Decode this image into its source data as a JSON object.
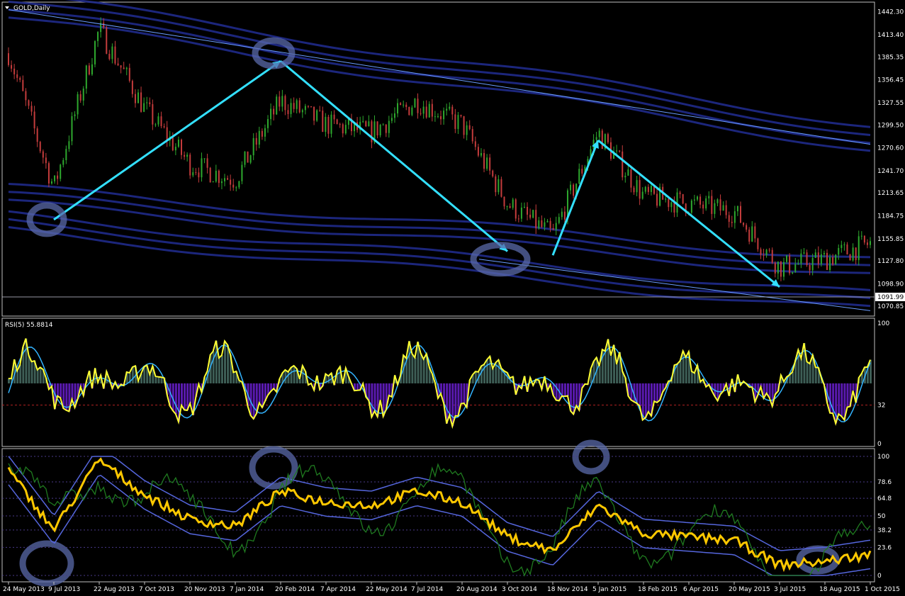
{
  "main": {
    "title": "GOLD,Daily",
    "price_axis": [
      "1442.30",
      "1413.40",
      "1385.35",
      "1356.45",
      "1327.55",
      "1299.50",
      "1270.60",
      "1241.70",
      "1213.65",
      "1184.75",
      "1155.85",
      "1127.80",
      "1098.90",
      "1070.85"
    ],
    "current_price": "1091.99"
  },
  "rsi_panel": {
    "title": "RSI(5) 55.8814",
    "levels": [
      "100",
      "32",
      "0"
    ]
  },
  "stoch_panel": {
    "levels": [
      "100",
      "78.6",
      "64.8",
      "50",
      "38.2",
      "23.6",
      "0"
    ]
  },
  "time_axis": [
    "24 May 2013",
    "9 Jul 2013",
    "22 Aug 2013",
    "7 Oct 2013",
    "20 Nov 2013",
    "7 Jan 2014",
    "20 Feb 2014",
    "7 Apr 2014",
    "22 May 2014",
    "7 Jul 2014",
    "20 Aug 2014",
    "3 Oct 2014",
    "18 Nov 2014",
    "5 Jan 2015",
    "18 Feb 2015",
    "6 Apr 2015",
    "20 May 2015",
    "3 Jul 2015",
    "18 Aug 2015",
    "1 Oct 2015"
  ],
  "chart_data": {
    "type": "line",
    "title": "GOLD,Daily",
    "ylim": [
      1060,
      1450
    ],
    "price_path": {
      "x": [
        "24 May 2013",
        "9 Jul 2013",
        "22 Aug 2013",
        "7 Oct 2013",
        "20 Nov 2013",
        "7 Jan 2014",
        "20 Feb 2014",
        "7 Apr 2014",
        "22 May 2014",
        "7 Jul 2014",
        "20 Aug 2014",
        "3 Oct 2014",
        "18 Nov 2014",
        "5 Jan 2015",
        "18 Feb 2015",
        "6 Apr 2015",
        "20 May 2015",
        "3 Jul 2015",
        "18 Aug 2015",
        "1 Oct 2015"
      ],
      "y": [
        1390,
        1220,
        1420,
        1320,
        1250,
        1230,
        1330,
        1300,
        1290,
        1330,
        1300,
        1200,
        1160,
        1290,
        1210,
        1200,
        1190,
        1120,
        1130,
        1150
      ]
    },
    "wave_arrows": [
      {
        "from": [
          "9 Jul 2013",
          1180
        ],
        "to": [
          "20 Feb 2014",
          1380
        ]
      },
      {
        "from": [
          "20 Feb 2014",
          1380
        ],
        "to": [
          "3 Oct 2014",
          1140
        ]
      },
      {
        "from": [
          "18 Nov 2014",
          1135
        ],
        "to": [
          "5 Jan 2015",
          1280
        ]
      },
      {
        "from": [
          "5 Jan 2015",
          1280
        ],
        "to": [
          "3 Jul 2015",
          1095
        ]
      }
    ],
    "rsi_ylim": [
      0,
      100
    ],
    "rsi_reference_level": 32,
    "stoch_ylim": [
      0,
      100
    ],
    "stoch_levels": [
      100,
      78.6,
      64.8,
      50,
      38.2,
      23.6,
      0
    ],
    "colors": {
      "candles_up": "#2ea82e",
      "candles_down": "#c43c3c",
      "arrows": "#33e0ff",
      "channels": "#1f2a8a",
      "rsi_line": "#ffff33",
      "rsi_signal": "#33b4ff",
      "histogram_up": "#3e5e56",
      "histogram_down": "#5a1ab0",
      "stoch_main": "#ffc800",
      "stoch_signal": "#1f7a1f",
      "bands": "#5566dd"
    }
  }
}
